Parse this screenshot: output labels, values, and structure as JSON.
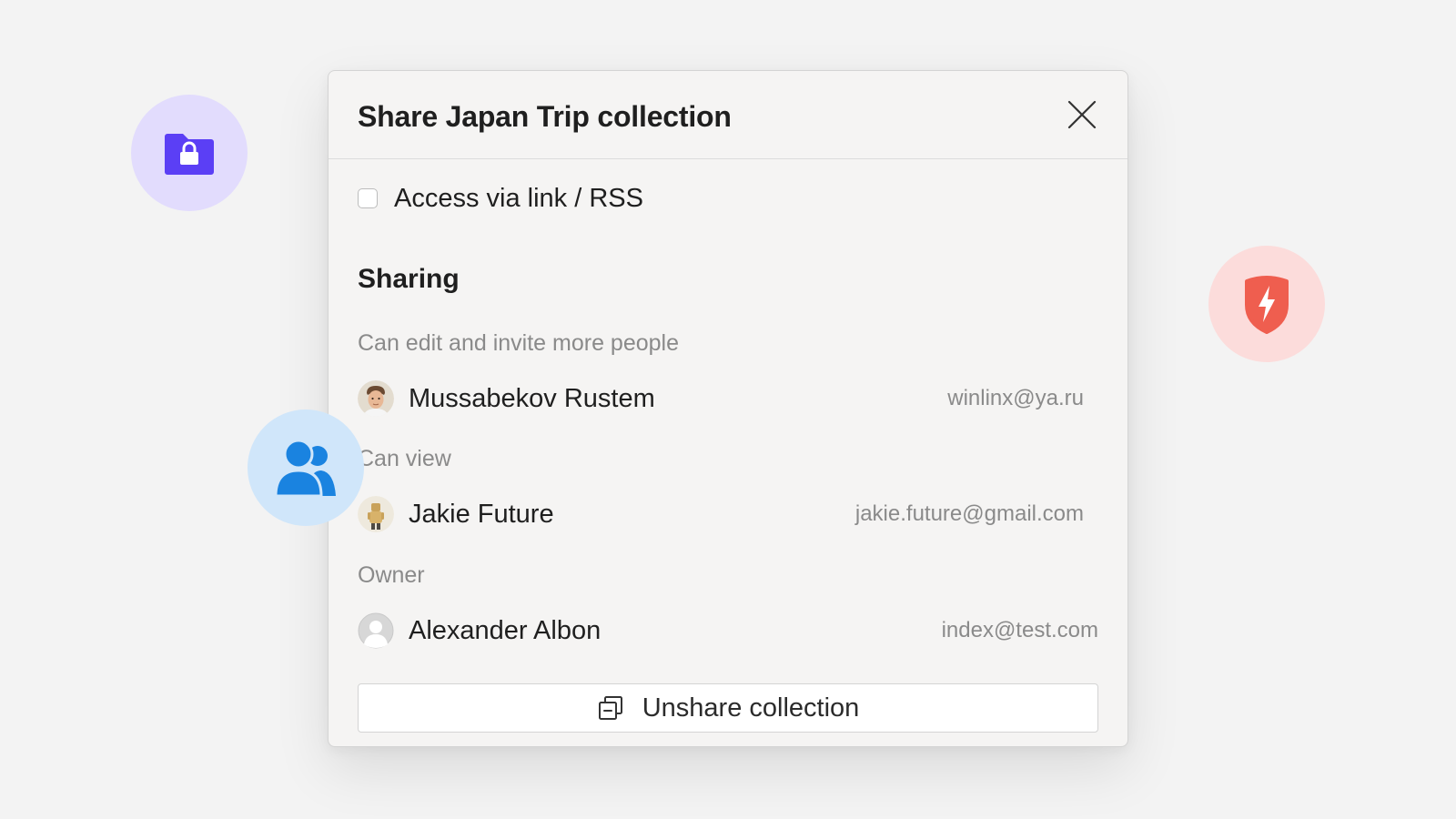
{
  "dialog": {
    "title": "Share Japan Trip collection",
    "close_icon": "close-icon"
  },
  "link_access": {
    "label": "Access via link / RSS",
    "checked": false
  },
  "sharing": {
    "title": "Sharing",
    "groups": [
      {
        "label": "Can edit and invite more people",
        "members": [
          {
            "name": "Mussabekov Rustem",
            "email": "winlinx@ya.ru"
          }
        ]
      },
      {
        "label": "Can view",
        "members": [
          {
            "name": "Jakie Future",
            "email": "jakie.future@gmail.com"
          }
        ]
      },
      {
        "label": "Owner",
        "members": [
          {
            "name": "Alexander Albon",
            "email": "index@test.com"
          }
        ]
      }
    ]
  },
  "unshare": {
    "label": "Unshare collection",
    "icon": "unshare-icon"
  },
  "decor": {
    "folder_icon": "locked-folder-icon",
    "shield_icon": "shield-bolt-icon",
    "people_icon": "people-icon"
  },
  "colors": {
    "background": "#f3f3f3",
    "dialog_background": "#f5f4f3",
    "folder_bubble": "#e2dcfd",
    "folder_icon": "#5b3ff5",
    "shield_bubble": "#fcdcdb",
    "shield_icon": "#ef5e4f",
    "people_bubble": "#d0e6fa",
    "people_icon": "#1a83e0",
    "muted_text": "#8a8a8a"
  }
}
